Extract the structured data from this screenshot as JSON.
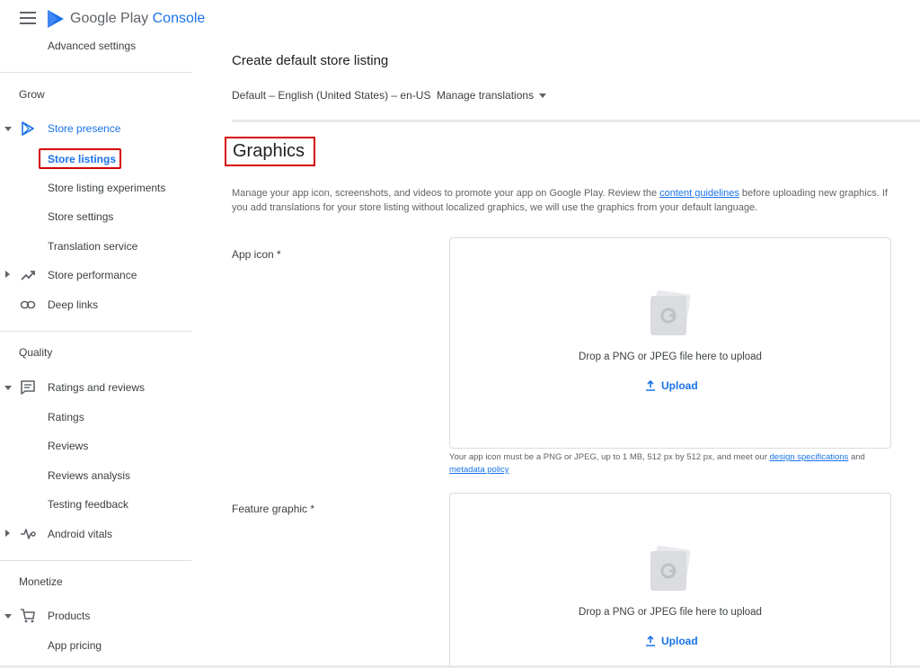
{
  "brand": {
    "google": "Google Play",
    "console": "Console"
  },
  "sidebar": {
    "advanced_settings": "Advanced settings",
    "grow": {
      "title": "Grow",
      "store_presence": "Store presence",
      "store_listings": "Store listings",
      "store_listing_experiments": "Store listing experiments",
      "store_settings": "Store settings",
      "translation_service": "Translation service",
      "store_performance": "Store performance",
      "deep_links": "Deep links"
    },
    "quality": {
      "title": "Quality",
      "ratings_and_reviews": "Ratings and reviews",
      "ratings": "Ratings",
      "reviews": "Reviews",
      "reviews_analysis": "Reviews analysis",
      "testing_feedback": "Testing feedback",
      "android_vitals": "Android vitals"
    },
    "monetize": {
      "title": "Monetize",
      "products": "Products",
      "app_pricing": "App pricing"
    }
  },
  "main": {
    "page_title": "Create default store listing",
    "language": "Default – English (United States) – en-US",
    "manage_translations": "Manage translations",
    "graphics_heading": "Graphics",
    "desc_part1": "Manage your app icon, screenshots, and videos to promote your app on Google Play. Review the ",
    "desc_link": "content guidelines",
    "desc_part2": " before uploading new graphics. If you add translations for your store listing without localized graphics, we will use the graphics from your default language.",
    "app_icon_label": "App icon  *",
    "drop_text": "Drop a PNG or JPEG file here to upload",
    "upload_label": "Upload",
    "icon_help_part1": "Your app icon must be a PNG or JPEG, up to 1 MB, 512 px by 512 px, and meet our ",
    "icon_help_link1": "design specifications",
    "icon_help_part2": " and ",
    "icon_help_link2": "metadata policy",
    "feature_graphic_label": "Feature graphic  *"
  },
  "colors": {
    "accent": "#1a73e8",
    "highlight": "#d50000"
  }
}
